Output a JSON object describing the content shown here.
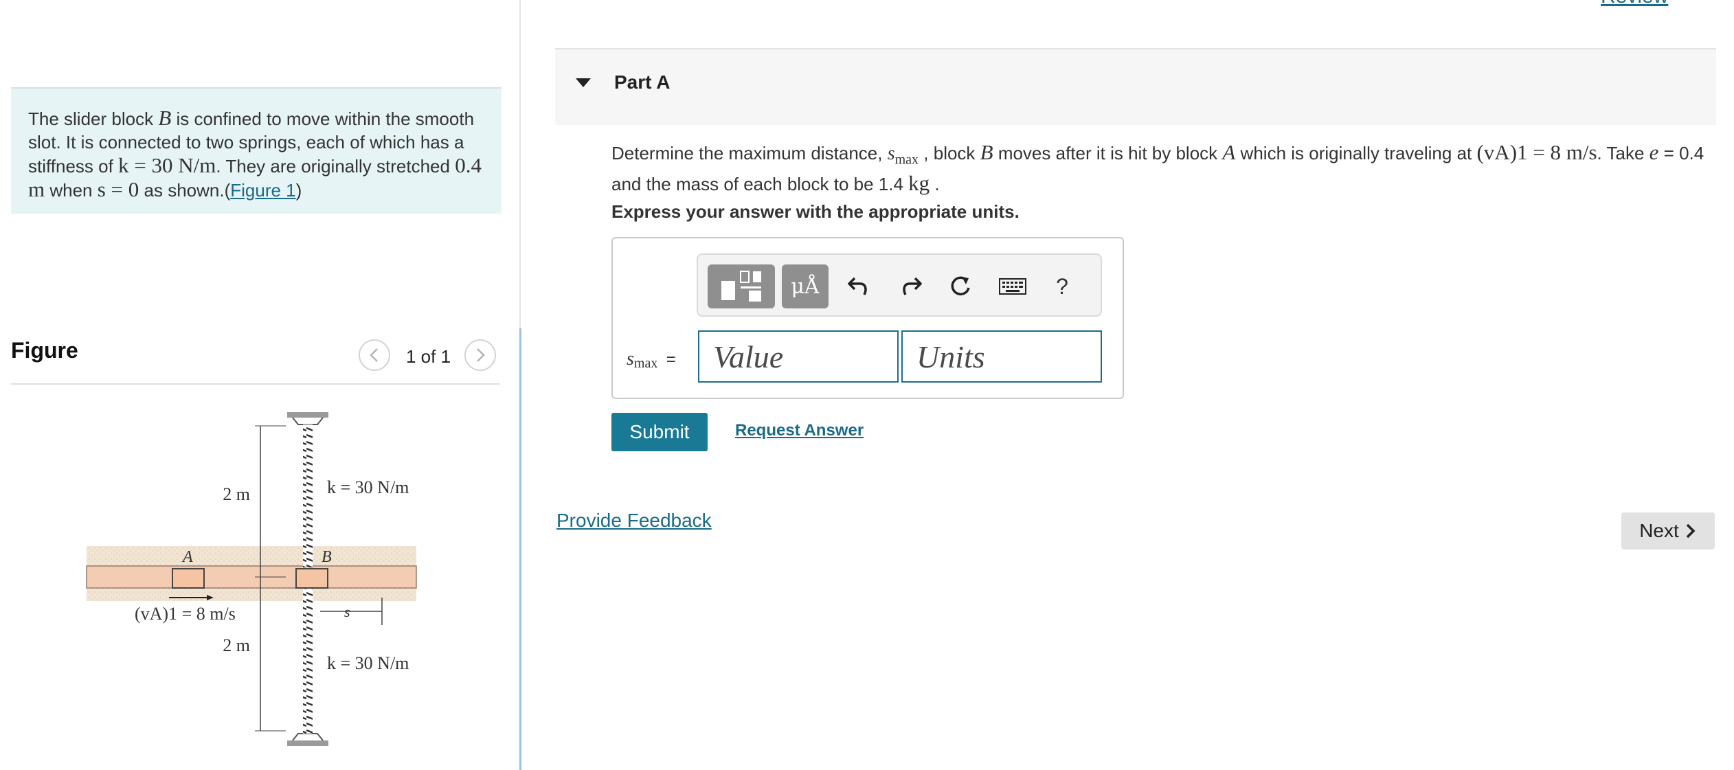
{
  "review": {
    "label": "Review"
  },
  "problem": {
    "t1": "The slider block ",
    "var_B": "B",
    "t2": " is confined to move within the smooth slot. It is connected to two springs, each of which has a stiffness of ",
    "math_k": "k = 30 N/m",
    "t3": ". They are originally stretched ",
    "math_dist": "0.4 m",
    "t4": " when ",
    "math_s": "s = 0",
    "t5": " as shown.(",
    "figure_link": "Figure 1",
    "t6": ")"
  },
  "figure": {
    "title": "Figure",
    "pager": "1 of 1",
    "prev_icon": "chevron-left-icon",
    "next_icon": "chevron-right-icon",
    "labels": {
      "dist_top": "2 m",
      "dist_bottom": "2 m",
      "k_top": "k = 30 N/m",
      "k_bottom": "k = 30 N/m",
      "block_a": "A",
      "block_b": "B",
      "velocity": "(vA)1 = 8 m/s",
      "s": "s"
    }
  },
  "part": {
    "title": "Part A",
    "caret_icon": "caret-down-icon"
  },
  "question": {
    "t1": "Determine the maximum distance, ",
    "var_smax": "smax",
    "t2": " , block ",
    "var_B": "B",
    "t3": " moves after it is hit by block ",
    "var_A": "A",
    "t4": " which is originally traveling at ",
    "math_v": "(vA)1 = 8 m/s",
    "t5": ". Take ",
    "math_e": "e",
    "t6": " = 0.4 and the mass of each block to be 1.4 ",
    "math_kg": "kg",
    "t7": " ."
  },
  "instruction": "Express your answer with the appropriate units.",
  "toolbar": {
    "template_icon": "templates-icon",
    "units_label": "μÅ",
    "undo_icon": "undo-icon",
    "redo_icon": "redo-icon",
    "reset_icon": "reset-icon",
    "keyboard_icon": "keyboard-icon",
    "help_label": "?"
  },
  "answer": {
    "var_label": "s",
    "var_sub": "max",
    "equals": "=",
    "value_placeholder": "Value",
    "units_placeholder": "Units"
  },
  "actions": {
    "submit": "Submit",
    "request_answer": "Request Answer",
    "feedback": "Provide Feedback",
    "next": "Next",
    "next_icon": "chevron-right-icon"
  },
  "colors": {
    "accent": "#1a7a96",
    "problem_bg": "#e6f4f5",
    "link": "#1b6a8a"
  }
}
